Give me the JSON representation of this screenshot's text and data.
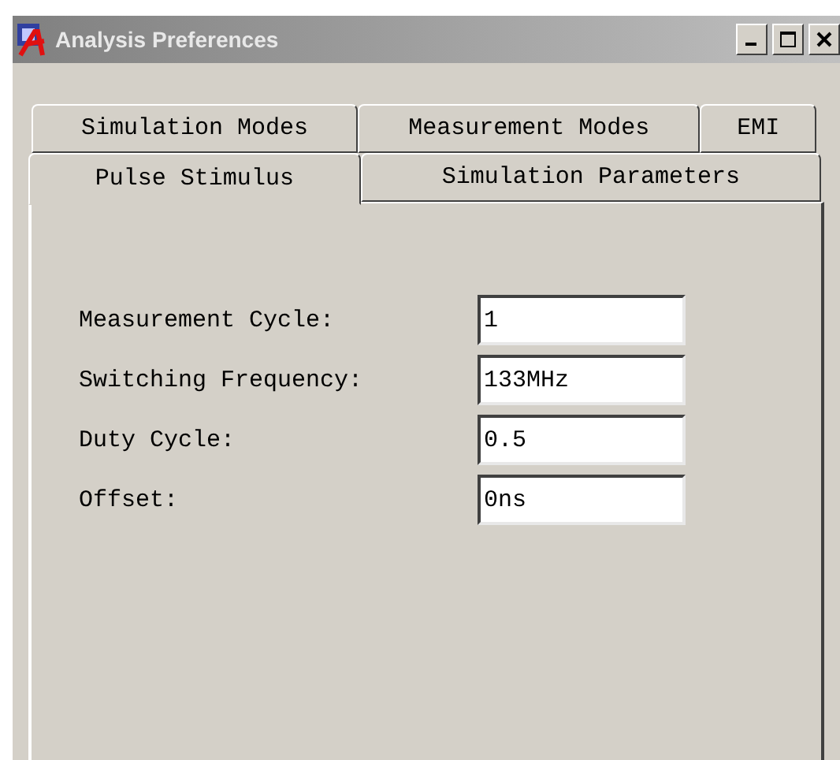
{
  "window": {
    "title": "Analysis Preferences"
  },
  "tab_rows": [
    [
      {
        "label": "Simulation Modes",
        "selected": false
      },
      {
        "label": "Measurement Modes",
        "selected": false
      },
      {
        "label": "EMI",
        "selected": false
      }
    ],
    [
      {
        "label": "Pulse Stimulus",
        "selected": true
      },
      {
        "label": "Simulation Parameters",
        "selected": false
      }
    ]
  ],
  "fields": [
    {
      "label": "Measurement Cycle:",
      "value": "1"
    },
    {
      "label": "Switching Frequency:",
      "value": "133MHz"
    },
    {
      "label": "Duty Cycle:",
      "value": "0.5"
    },
    {
      "label": "Offset:",
      "value": "0ns"
    }
  ]
}
